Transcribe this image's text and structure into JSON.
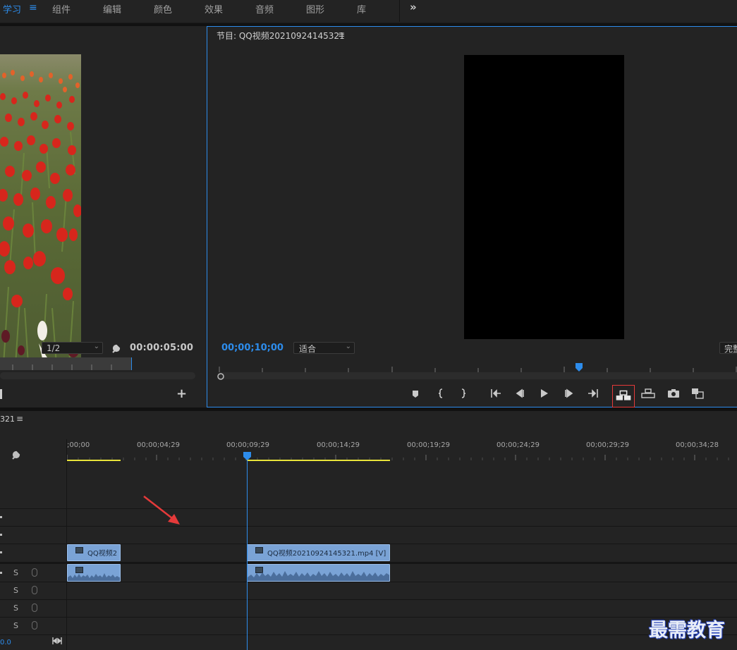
{
  "workspace_tabs": [
    "学习",
    "组件",
    "编辑",
    "颜色",
    "效果",
    "音频",
    "图形",
    "库"
  ],
  "overflow_icon": "double-chevron-right-icon",
  "menu_glyph": "≡",
  "source_panel": {
    "resolution": "1/2",
    "duration": "00:00:05:00",
    "add_glyph": "+"
  },
  "program_monitor": {
    "title": "节目: QQ视频20210924145321",
    "timecode": "00;00;10;00",
    "fit_dropdown": "适合",
    "quality_dropdown": "完整",
    "playhead_progress": 0.685
  },
  "timeline": {
    "sequence_suffix": "321",
    "ruler_labels": [
      ";00;00",
      "00;00;04;29",
      "00;00;09;29",
      "00;00;14;29",
      "00;00;19;29",
      "00;00;24;29",
      "00;00;29;29",
      "00;00;34;28"
    ],
    "clips": [
      {
        "label": "QQ视频2",
        "track": "video"
      },
      {
        "label": "QQ视频20210924145321.mp4 [V]",
        "track": "video"
      }
    ],
    "solo_labels": [
      "S",
      "S",
      "S",
      "S"
    ],
    "bottom_value": "0.0"
  },
  "watermark": "最需教育",
  "colors": {
    "accent": "#2d8ceb",
    "clip_blue": "#7aa3d6",
    "work_area_yellow": "#e8e33a",
    "highlight_red": "#e53a3a"
  }
}
